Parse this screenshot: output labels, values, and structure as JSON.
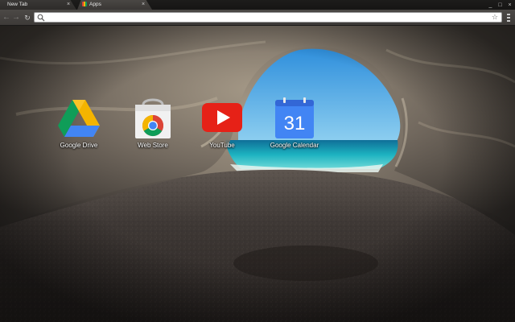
{
  "tabs": [
    {
      "label": "New Tab",
      "active": true
    },
    {
      "label": "Apps",
      "active": false
    }
  ],
  "tab_close_glyph": "×",
  "window_controls": {
    "minimize": "_",
    "maximize": "□",
    "close": "×"
  },
  "toolbar": {
    "back_glyph": "←",
    "forward_glyph": "→",
    "reload_glyph": "↻",
    "omnibox_value": "",
    "omnibox_placeholder": "",
    "star_glyph": "☆"
  },
  "apps": [
    {
      "label": "Google Drive",
      "icon": "google-drive-icon"
    },
    {
      "label": "Web Store",
      "icon": "chrome-web-store-icon"
    },
    {
      "label": "YouTube",
      "icon": "youtube-icon"
    },
    {
      "label": "Google Calendar",
      "icon": "google-calendar-icon",
      "day": "31"
    }
  ],
  "colors": {
    "drive_green": "#0f9d58",
    "drive_yellow": "#f4b400",
    "drive_blue": "#4285f4",
    "youtube_red": "#e62117",
    "calendar_blue": "#4285f4",
    "sea": "#1fb5c4",
    "sky": "#3c9be0"
  }
}
